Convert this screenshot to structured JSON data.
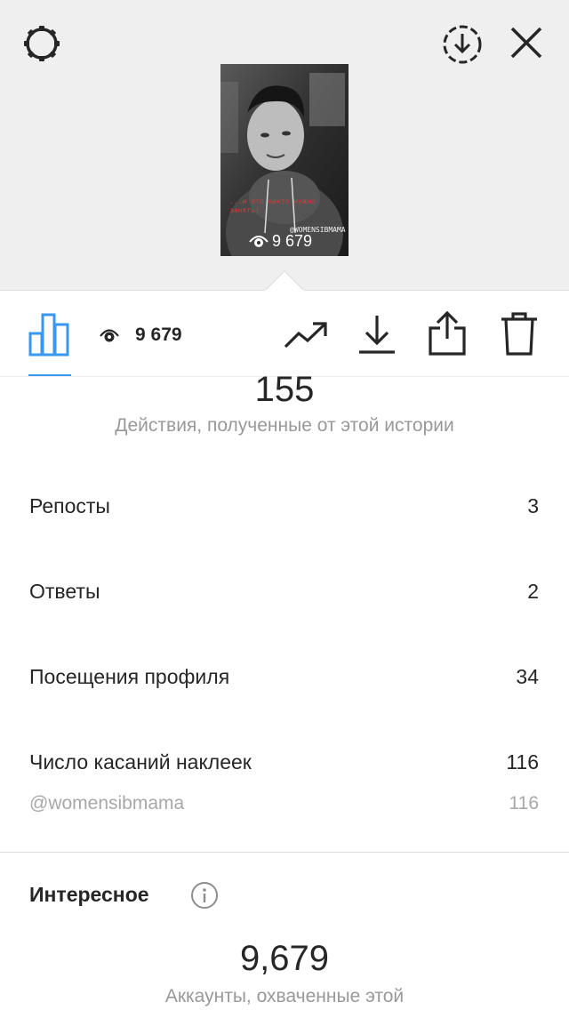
{
  "header": {
    "settings_icon": "gear-icon",
    "download_icon": "download-circle-icon",
    "close_icon": "close-icon"
  },
  "story": {
    "caption": "...и это никто нужно занять!",
    "handle": "@WOMENSIBMAMA",
    "views": "9 679"
  },
  "tabbar": {
    "insights_icon": "bar-chart-icon",
    "views_icon": "eye-icon",
    "views_count": "9 679",
    "promote_icon": "trending-up-icon",
    "save_icon": "save-icon",
    "share_icon": "share-icon",
    "delete_icon": "trash-icon",
    "accent_color": "#3897f0"
  },
  "interactions": {
    "total": "155",
    "caption": "Действия, полученные от этой истории",
    "rows": [
      {
        "label": "Репосты",
        "value": "3"
      },
      {
        "label": "Ответы",
        "value": "2"
      },
      {
        "label": "Посещения профиля",
        "value": "34"
      },
      {
        "label": "Число касаний наклеек",
        "value": "116"
      }
    ],
    "sticker": {
      "label": "@womensibmama",
      "value": "116"
    }
  },
  "discovery": {
    "title": "Интересное",
    "info_icon": "info-icon",
    "total": "9,679",
    "caption": "Аккаунты, охваченные этой"
  }
}
